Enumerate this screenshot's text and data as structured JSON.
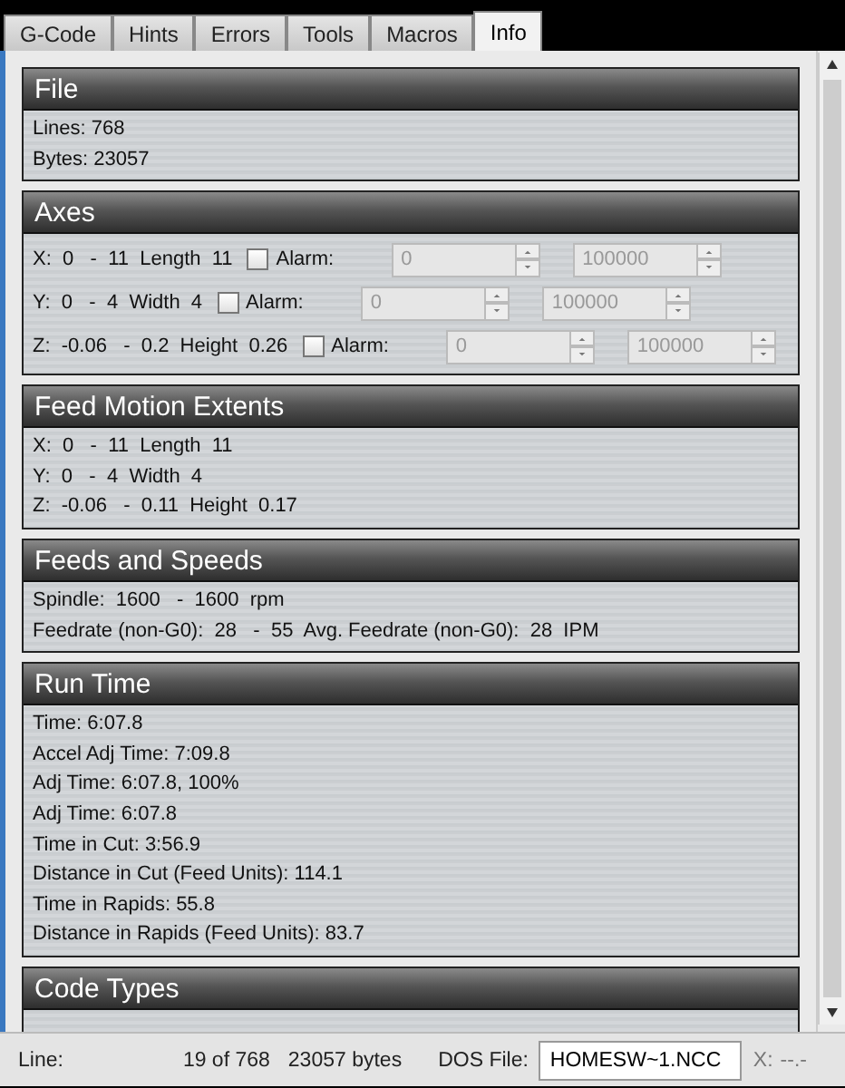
{
  "tabs": [
    {
      "label": "G-Code",
      "selected": false
    },
    {
      "label": "Hints",
      "selected": false
    },
    {
      "label": "Errors",
      "selected": false
    },
    {
      "label": "Tools",
      "selected": false
    },
    {
      "label": "Macros",
      "selected": false
    },
    {
      "label": "Info",
      "selected": true
    }
  ],
  "sections": [
    {
      "kind": "lines",
      "title": "File",
      "lines": [
        "Lines: 768",
        "Bytes: 23057"
      ]
    },
    {
      "kind": "axes",
      "title": "Axes",
      "rows": [
        {
          "text": "X:  0   -  11  Length  11",
          "alarm_label": "Alarm:",
          "checked": false,
          "low": {
            "value": "0",
            "disabled": true
          },
          "high": {
            "value": "100000",
            "disabled": true
          }
        },
        {
          "text": "Y:  0   -  4  Width  4",
          "alarm_label": "Alarm:",
          "checked": false,
          "low": {
            "value": "0",
            "disabled": true
          },
          "high": {
            "value": "100000",
            "disabled": true
          }
        },
        {
          "text": "Z:  -0.06   -  0.2  Height  0.26",
          "alarm_label": "Alarm:",
          "checked": false,
          "low": {
            "value": "0",
            "disabled": true
          },
          "high": {
            "value": "100000",
            "disabled": true
          }
        }
      ]
    },
    {
      "kind": "lines",
      "title": "Feed Motion Extents",
      "lines": [
        "X:  0   -  11  Length  11",
        "Y:  0   -  4  Width  4",
        "Z:  -0.06   -  0.11  Height  0.17"
      ]
    },
    {
      "kind": "lines",
      "title": "Feeds and Speeds",
      "lines": [
        "Spindle:  1600   -  1600  rpm",
        "Feedrate (non-G0):  28   -  55  Avg. Feedrate (non-G0):  28  IPM"
      ]
    },
    {
      "kind": "lines",
      "title": "Run Time",
      "lines": [
        "Time: 6:07.8",
        "Accel Adj Time: 7:09.8",
        "Adj Time: 6:07.8, 100%",
        "Adj Time: 6:07.8",
        "Time in Cut: 3:56.9",
        "Distance in Cut (Feed Units): 114.1",
        "Time in Rapids: 55.8",
        "Distance in Rapids (Feed Units): 83.7"
      ]
    },
    {
      "kind": "lines",
      "title": "Code Types"
    }
  ],
  "status_bar": {
    "line_label": "Line:",
    "position": "19 of 768",
    "bytes": "23057 bytes",
    "dos_label": "DOS File:",
    "dos_file": "HOMESW~1.NCC",
    "x_label": "X:",
    "x_value": "--.-"
  }
}
